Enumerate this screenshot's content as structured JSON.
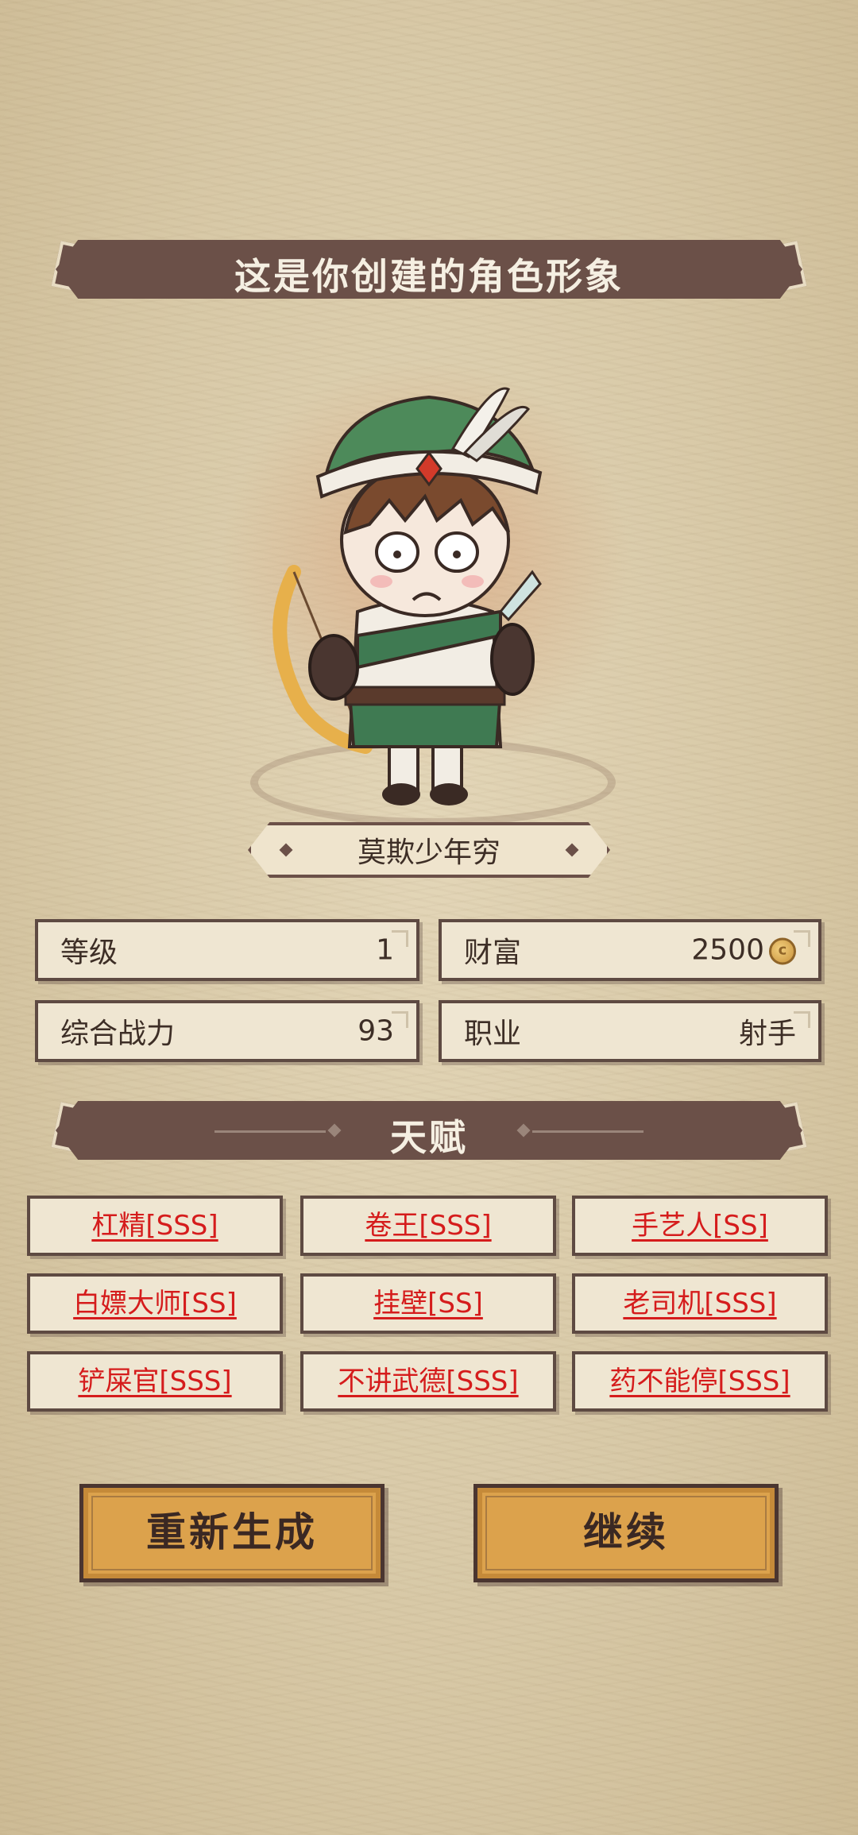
{
  "header": {
    "title": "这是你创建的角色形象"
  },
  "character": {
    "name": "莫欺少年穷"
  },
  "stats": {
    "level": {
      "label": "等级",
      "value": "1"
    },
    "wealth": {
      "label": "财富",
      "value": "2500"
    },
    "power": {
      "label": "综合战力",
      "value": "93"
    },
    "class": {
      "label": "职业",
      "value": "射手"
    }
  },
  "talents_section": {
    "title": "天赋"
  },
  "talents": [
    "杠精[SSS]",
    "卷王[SSS]",
    "手艺人[SS]",
    "白嫖大师[SS]",
    "挂壁[SS]",
    "老司机[SSS]",
    "铲屎官[SSS]",
    "不讲武德[SSS]",
    "药不能停[SSS]"
  ],
  "actions": {
    "regenerate_label": "重新生成",
    "continue_label": "继续"
  },
  "colors": {
    "ribbon": "#6b5048",
    "talent_text": "#d51c1c",
    "button": "#dca24c"
  }
}
